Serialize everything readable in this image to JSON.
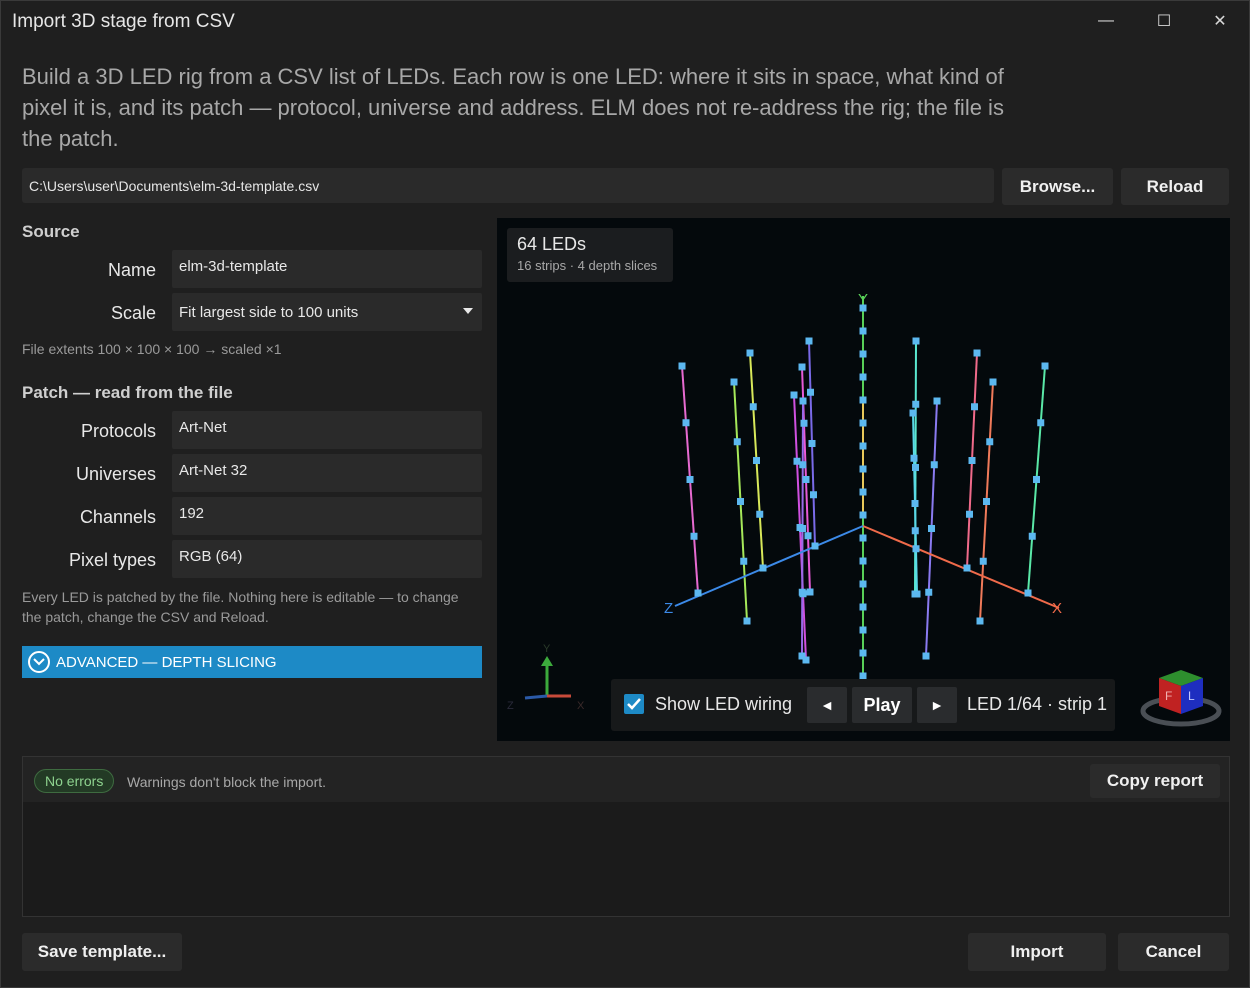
{
  "window": {
    "title": "Import 3D stage from CSV",
    "minimize_glyph": "—",
    "maximize_glyph": "☐",
    "close_glyph": "✕"
  },
  "intro": "Build a 3D LED rig from a CSV list of LEDs. Each row is one LED: where it sits in space, what kind of pixel it is, and its patch — protocol, universe and address. ELM does not re-address the rig; the file is the patch.",
  "file": {
    "path": "C:\\Users\\user\\Documents\\elm-3d-template.csv",
    "browse_label": "Browse...",
    "reload_label": "Reload"
  },
  "source": {
    "heading": "Source",
    "name_label": "Name",
    "name_value": "elm-3d-template",
    "scale_label": "Scale",
    "scale_value": "Fit largest side to 100 units",
    "extents": "File extents 100 × 100 × 100 → scaled ×1"
  },
  "patch": {
    "heading": "Patch — read from the file",
    "protocols_label": "Protocols",
    "protocols_value": "Art-Net",
    "universes_label": "Universes",
    "universes_value": "Art-Net 32",
    "channels_label": "Channels",
    "channels_value": "192",
    "pixel_types_label": "Pixel types",
    "pixel_types_value": "RGB (64)",
    "note": "Every LED is patched by the file. Nothing here is editable — to change the patch, change the CSV and Reload."
  },
  "advanced": {
    "label": "ADVANCED — DEPTH SLICING"
  },
  "viewport": {
    "led_count": "64 LEDs",
    "detail": "16 strips · 4 depth slices",
    "axis_x": "X",
    "axis_y": "Y",
    "axis_z": "Z",
    "gizmo_x": "X",
    "gizmo_y": "Y",
    "gizmo_z": "Z",
    "cube_front": "F",
    "cube_left": "L",
    "show_wiring_label": "Show LED wiring",
    "show_wiring_checked": true,
    "prev_glyph": "◄",
    "play_label": "Play",
    "next_glyph": "►",
    "led_status": "LED 1/64 · strip 1",
    "led_color": "#5cb8f0"
  },
  "report": {
    "status": "No errors",
    "note": "Warnings don't block the import.",
    "copy_label": "Copy report"
  },
  "footer": {
    "save_template_label": "Save template...",
    "import_label": "Import",
    "cancel_label": "Cancel"
  },
  "colors": {
    "accent": "#1d8ac6",
    "ok": "#8ed38f"
  }
}
